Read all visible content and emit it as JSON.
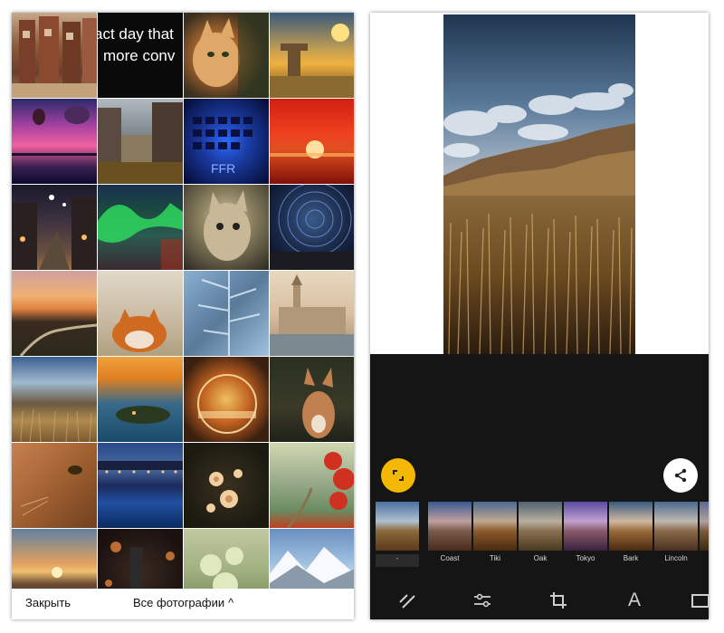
{
  "picker": {
    "thumbnail_text": [
      "act day that",
      "more conv"
    ],
    "close_label": "Закрыть",
    "all_photos_label": "Все фотографии",
    "all_photos_caret": "^"
  },
  "editor": {
    "filters": [
      {
        "label": "-"
      },
      {
        "label": "Coast"
      },
      {
        "label": "Tiki"
      },
      {
        "label": "Oak"
      },
      {
        "label": "Tokyo"
      },
      {
        "label": "Bark"
      },
      {
        "label": "Lincoln"
      }
    ],
    "toolbar": {
      "text_tool_glyph": "A"
    }
  },
  "colors": {
    "accent_yellow": "#f5b800",
    "editor_background": "#151515"
  }
}
